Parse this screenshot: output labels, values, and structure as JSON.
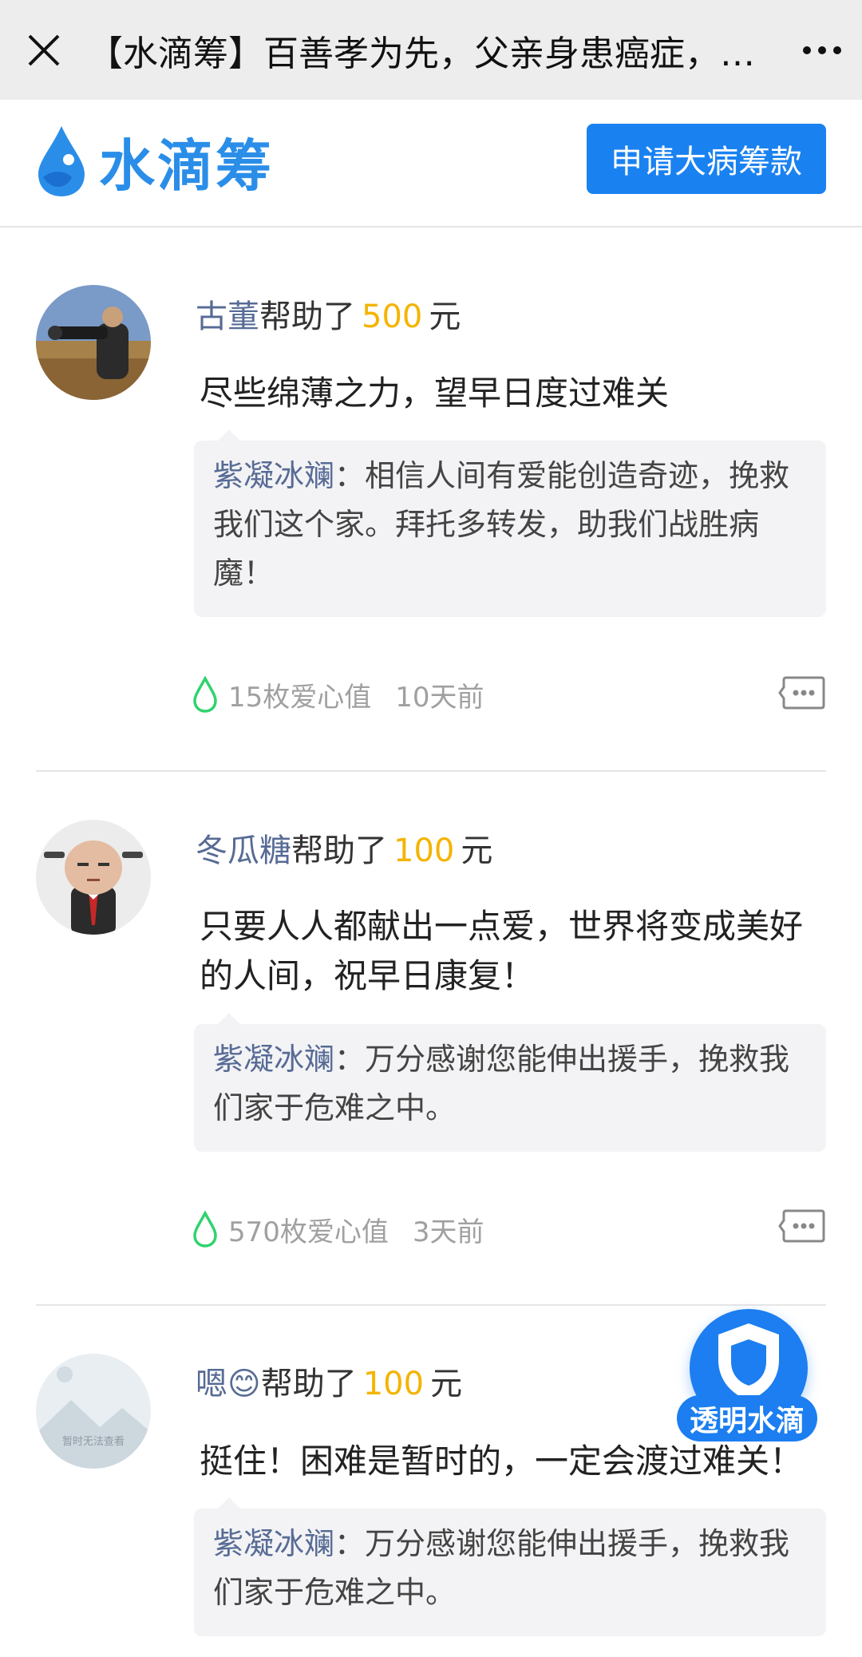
{
  "topbar": {
    "title": "【水滴筹】百善孝为先，父亲身患癌症，…"
  },
  "header": {
    "logo_text": "水滴筹",
    "apply_button": "申请大病筹款"
  },
  "common": {
    "helped_text": "帮助了",
    "currency": "元"
  },
  "entries": [
    {
      "name": "古董",
      "amount": "500",
      "message": "尽些绵薄之力，望早日度过难关",
      "reply_name": "紫凝冰斓",
      "reply_text": "相信人间有爱能创造奇迹，挽救我们这个家。拜托多转发，助我们战胜病魔！",
      "love": "15枚爱心值",
      "time": "10天前"
    },
    {
      "name": "冬瓜糖",
      "amount": "100",
      "message": "只要人人都献出一点爱，世界将变成美好的人间，祝早日康复！",
      "reply_name": "紫凝冰斓",
      "reply_text": "万分感谢您能伸出援手，挽救我们家于危难之中。",
      "love": "570枚爱心值",
      "time": "3天前"
    },
    {
      "name": "嗯😊",
      "amount": "100",
      "message": "挺住！困难是暂时的，一定会渡过难关！",
      "reply_name": "紫凝冰斓",
      "reply_text": "万分感谢您能伸出援手，挽救我们家于危难之中。",
      "avatar_placeholder": "暂时无法查看"
    }
  ],
  "badge": {
    "label": "透明水滴"
  },
  "colors": {
    "brand": "#1a82f0",
    "name_link": "#576b95",
    "amount": "#f4b400",
    "love_drop": "#2fd36e"
  }
}
